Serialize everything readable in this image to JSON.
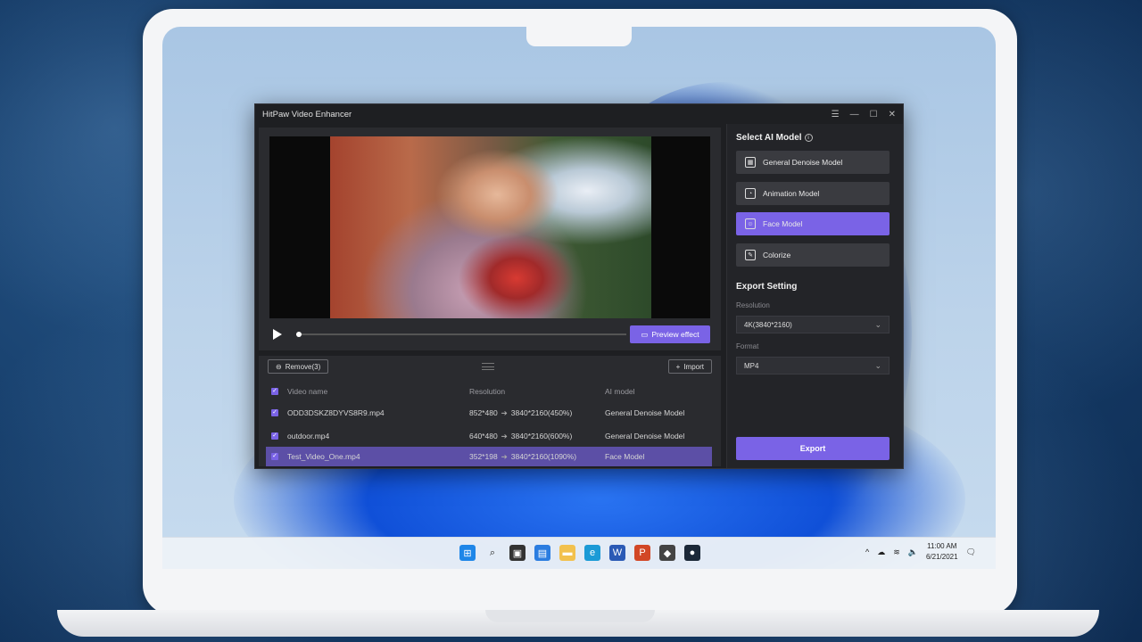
{
  "app": {
    "title": "HitPaw Video Enhancer",
    "controls": [
      "☰",
      "—",
      "☐",
      "✕"
    ]
  },
  "preview": {
    "preview_button_label": "Preview effect"
  },
  "list": {
    "remove_label": "Remove(3)",
    "import_label": "Import",
    "columns": {
      "name": "Video name",
      "resolution": "Resolution",
      "model": "AI model"
    },
    "rows": [
      {
        "name": "ODD3DSKZ8DYVS8R9.mp4",
        "from": "852*480",
        "to": "3840*2160(450%)",
        "model": "General Denoise Model"
      },
      {
        "name": "outdoor.mp4",
        "from": "640*480",
        "to": "3840*2160(600%)",
        "model": "General Denoise Model"
      },
      {
        "name": "Test_Video_One.mp4",
        "from": "352*198",
        "to": "3840*2160(1090%)",
        "model": "Face Model"
      }
    ]
  },
  "ai_model": {
    "title": "Select AI Model",
    "models": [
      {
        "label": "General Denoise Model",
        "icon": "film-icon",
        "active": false
      },
      {
        "label": "Animation Model",
        "icon": "shapes-icon",
        "active": false
      },
      {
        "label": "Face Model",
        "icon": "face-icon",
        "active": true
      },
      {
        "label": "Colorize",
        "icon": "paint-icon",
        "active": false
      }
    ]
  },
  "export": {
    "title": "Export Setting",
    "resolution_label": "Resolution",
    "resolution_value": "4K(3840*2160)",
    "format_label": "Format",
    "format_value": "MP4",
    "export_label": "Export"
  },
  "taskbar": {
    "time": "11:00 AM",
    "date": "6/21/2021"
  },
  "colors": {
    "accent": "#7a63e6",
    "selected_row": "#5c4fa6"
  }
}
